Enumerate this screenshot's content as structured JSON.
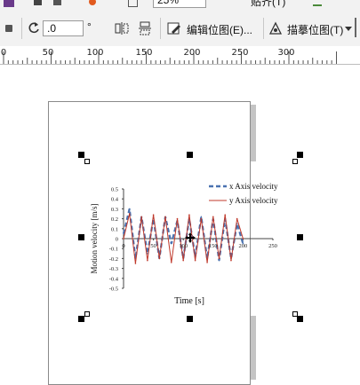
{
  "toolbar": {
    "zoom_value": "25%",
    "snap_label": "贴齐(T)",
    "rotation_value": ".0",
    "degree_symbol": "°",
    "edit_bitmap_label": "编辑位图(E)...",
    "trace_bitmap_label": "描摹位图(T)"
  },
  "ruler": {
    "labels": [
      "0",
      "50",
      "100",
      "150",
      "200",
      "250",
      "300"
    ]
  },
  "chart_data": {
    "type": "line",
    "xlabel": "Time [s]",
    "ylabel": "Motion velocity [m/s]",
    "xlim": [
      0,
      250
    ],
    "ylim": [
      -0.5,
      0.5
    ],
    "x_ticks": [
      "0",
      "50",
      "100",
      "150",
      "200",
      "250"
    ],
    "y_ticks": [
      "0.5",
      "0.4",
      "0.3",
      "0.2",
      "0.1",
      "0",
      "-0.1",
      "-0.2",
      "-0.3",
      "-0.4",
      "-0.5"
    ],
    "legend": "top-right",
    "series": [
      {
        "name": "x Axis velocity",
        "color": "#4a72b0",
        "style": "dashed",
        "x": [
          0,
          10,
          20,
          30,
          40,
          50,
          60,
          70,
          80,
          90,
          100,
          110,
          120,
          130,
          140,
          150,
          160,
          170,
          180,
          190,
          200
        ],
        "values": [
          0.05,
          0.3,
          -0.2,
          0.22,
          -0.15,
          0.2,
          -0.2,
          0.22,
          -0.05,
          0.18,
          -0.2,
          0.2,
          -0.18,
          0.22,
          -0.2,
          0.2,
          -0.22,
          0.2,
          -0.2,
          0.15,
          -0.05
        ]
      },
      {
        "name": "y Axis velocity",
        "color": "#c0392b",
        "style": "solid",
        "x": [
          0,
          10,
          20,
          30,
          40,
          50,
          60,
          70,
          80,
          90,
          100,
          110,
          120,
          130,
          140,
          150,
          160,
          170,
          180,
          190,
          200
        ],
        "values": [
          0.0,
          0.25,
          -0.25,
          0.22,
          -0.22,
          0.24,
          -0.2,
          0.22,
          -0.24,
          0.2,
          -0.22,
          0.24,
          -0.22,
          0.2,
          -0.24,
          0.22,
          -0.2,
          0.24,
          -0.22,
          0.2,
          0.0
        ]
      }
    ]
  }
}
